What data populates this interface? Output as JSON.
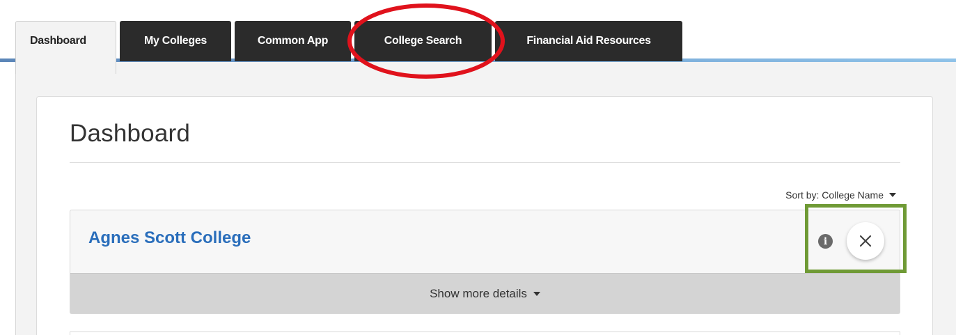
{
  "tabs": [
    {
      "label": "Dashboard",
      "active": true
    },
    {
      "label": "My Colleges",
      "active": false
    },
    {
      "label": "Common App",
      "active": false
    },
    {
      "label": "College Search",
      "active": false
    },
    {
      "label": "Financial Aid Resources",
      "active": false
    }
  ],
  "page": {
    "title": "Dashboard",
    "sort_label": "Sort by: College Name"
  },
  "colleges": [
    {
      "name": "Agnes Scott College",
      "details_label": "Show more details"
    }
  ],
  "icons": {
    "info": "info-icon",
    "close": "close-icon",
    "caret": "caret-down-icon"
  },
  "colors": {
    "tab_dark": "#2b2b2b",
    "link_blue": "#2a6ebb",
    "annotation_red": "#e0121c",
    "annotation_green": "#6f9a35"
  }
}
